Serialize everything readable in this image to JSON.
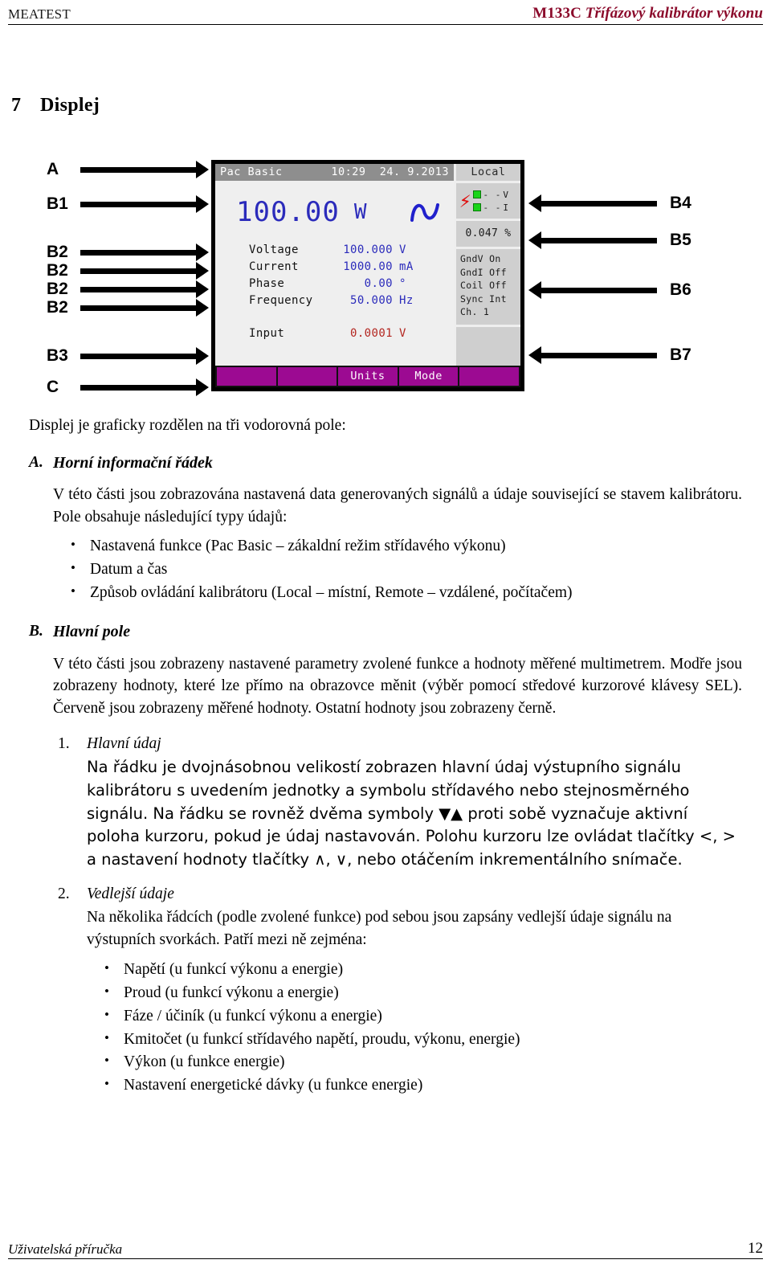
{
  "header": {
    "left": "MEATEST",
    "model": "M133C",
    "title": " Třífázový kalibrátor výkonu"
  },
  "section": {
    "number": "7",
    "title": "Displej"
  },
  "figure": {
    "left_callouts": [
      {
        "label": "A"
      },
      {
        "label": "B1"
      },
      {
        "label": "B2"
      },
      {
        "label": "B2"
      },
      {
        "label": "B2"
      },
      {
        "label": "B2"
      },
      {
        "label": "B3"
      },
      {
        "label": "C"
      }
    ],
    "right_callouts": [
      {
        "label": "B4"
      },
      {
        "label": "B5"
      },
      {
        "label": "B6"
      },
      {
        "label": "B7"
      }
    ]
  },
  "lcd": {
    "topbar": {
      "function": "Pac Basic",
      "time": "10:29",
      "date": "24. 9.2013",
      "control_mode": "Local"
    },
    "main_reading": {
      "value": "100.00",
      "unit": "W",
      "waveform_icon": "sine-wave-icon"
    },
    "parameters": [
      {
        "name": "Voltage",
        "value": "100.000",
        "unit": "V"
      },
      {
        "name": "Current",
        "value": "1000.00",
        "unit": "mA"
      },
      {
        "name": "Phase",
        "value": "0.00",
        "unit": "°"
      },
      {
        "name": "Frequency",
        "value": "50.000",
        "unit": "Hz"
      }
    ],
    "input": {
      "name": "Input",
      "value": "0.0001",
      "unit": "V"
    },
    "terminals": {
      "bolt_icon": "high-voltage-icon",
      "rows": [
        {
          "led": "led-green-icon",
          "dashes": "- -",
          "label": "V"
        },
        {
          "led": "led-green-icon",
          "dashes": "- -",
          "label": "I"
        }
      ]
    },
    "uncertainty": "0.047 %",
    "status_lines": [
      "GndV On",
      "GndI Off",
      "Coil Off",
      "Sync Int",
      "Ch. 1"
    ],
    "softkeys": [
      "",
      "",
      "Units",
      "Mode",
      ""
    ],
    "colors": {
      "set_value_blue": "#2b2bbb",
      "measured_red": "#b3251f",
      "softkey_purple": "#9c0a92",
      "topbar_gray": "#8e8e8e",
      "panel_gray": "#cfcfcf",
      "led_green": "#19d419",
      "bolt_red": "#e01010"
    }
  },
  "body": {
    "lead": "Displej je graficky rozdělen na tři vodorovná pole:",
    "section_a": {
      "marker": "A.",
      "title": "Horní informační řádek",
      "paragraph": "V této části jsou zobrazována nastavená data generovaných signálů a údaje související se stavem kalibrátoru. Pole obsahuje následující typy údajů:",
      "bullets": [
        "Nastavená funkce (Pac Basic – zákaldní režim střídavého výkonu)",
        "Datum a čas",
        "Způsob ovládání kalibrátoru (Local – místní, Remote – vzdálené, počítačem)"
      ]
    },
    "section_b": {
      "marker": "B.",
      "title": "Hlavní pole",
      "paragraph": "V této části jsou zobrazeny nastavené parametry zvolené funkce a hodnoty měřené multimetrem. Modře jsou zobrazeny hodnoty, které lze přímo na obrazovce měnit (výběr pomocí středové kurzorové klávesy SEL). Červeně jsou zobrazeny měřené hodnoty. Ostatní hodnoty jsou zobrazeny černě.",
      "items": [
        {
          "num": "1.",
          "title": "Hlavní údaj",
          "text": "Na řádku je dvojnásobnou velikostí zobrazen hlavní údaj výstupního signálu kalibrátoru s uvedením jednotky a symbolu střídavého nebo stejnosměrného signálu. Na řádku se rovněž dvěma symboly ▼▲ proti sobě vyznačuje aktivní poloha kurzoru, pokud je údaj nastavován. Polohu kurzoru lze ovládat tlačítky <, > a nastavení hodnoty tlačítky ∧, ∨, nebo otáčením inkrementálního snímače."
        },
        {
          "num": "2.",
          "title": "Vedlejší údaje",
          "text": "Na několika řádcích (podle zvolené funkce) pod sebou jsou zapsány vedlejší údaje signálu na výstupních svorkách. Patří mezi ně zejména:",
          "bullets": [
            "Napětí (u funkcí výkonu a energie)",
            "Proud (u funkcí výkonu a energie)",
            "Fáze / účiník (u funkcí výkonu a energie)",
            "Kmitočet (u funkcí střídavého napětí, proudu, výkonu, energie)",
            "Výkon (u funkce energie)",
            "Nastavení energetické dávky (u funkce energie)"
          ]
        }
      ]
    }
  },
  "footer": {
    "left": "Uživatelská příručka",
    "page": "12"
  }
}
